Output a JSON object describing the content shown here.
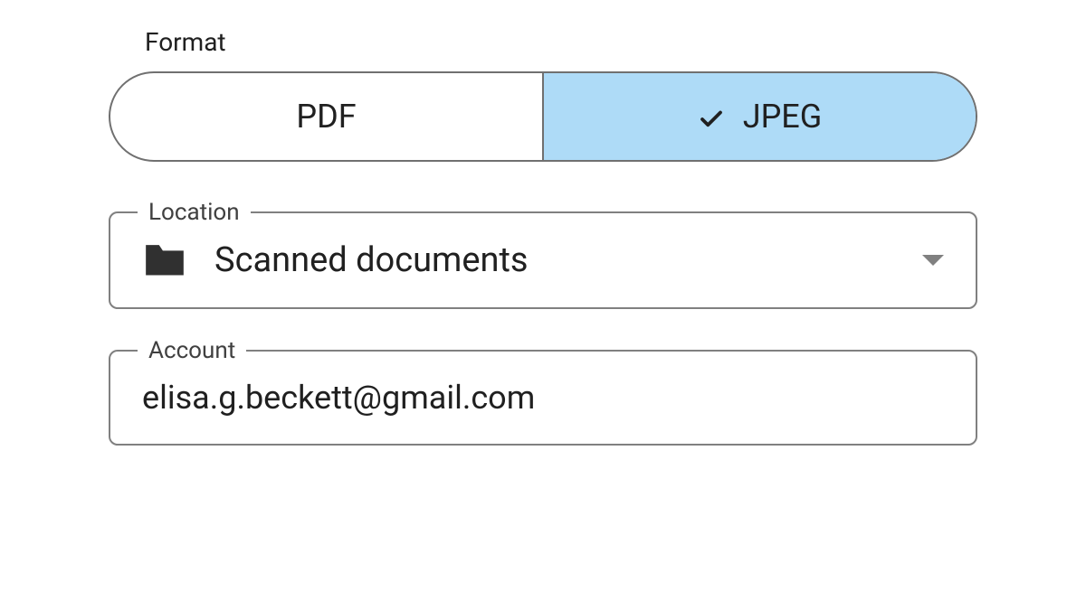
{
  "format": {
    "label": "Format",
    "options": {
      "pdf": "PDF",
      "jpeg": "JPEG"
    },
    "selected": "jpeg"
  },
  "location": {
    "label": "Location",
    "value": "Scanned documents"
  },
  "account": {
    "label": "Account",
    "value": "elisa.g.beckett@gmail.com"
  }
}
